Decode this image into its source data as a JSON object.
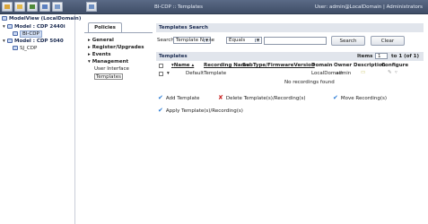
{
  "topbar": {
    "title": "BI-CDP :: Templates",
    "user": "User: admin@LocalDomain | Administrators",
    "icons": [
      "home-icon",
      "folder-icon",
      "chart-icon",
      "refresh-icon",
      "image-icon"
    ]
  },
  "tree": {
    "root": "ModelView (LocalDomain)",
    "model1": "Model : CDP 2440i",
    "model1_child": "BI-CDP",
    "model2": "Model : CDP 5040",
    "model2_child": "SJ_CDP"
  },
  "nav": {
    "tab": "Policies",
    "items": [
      "General",
      "Register/Upgrades",
      "Events",
      "Management"
    ],
    "sub_items": [
      "User Interface",
      "Templates"
    ]
  },
  "search": {
    "section_title": "Templates Search",
    "label": "Search:",
    "field_option": "Template Name",
    "operator_option": "Equals",
    "value": "",
    "search_button": "Search",
    "clear_button": "Clear"
  },
  "templates": {
    "section_title": "Templates",
    "items_label": "Items",
    "page_value": "1",
    "page_suffix": "to 1 (of 1)",
    "columns": [
      "Name",
      "Recording Name",
      "SubType/FirmwareVersion",
      "Domain",
      "Owner",
      "Description",
      "Configure"
    ],
    "row": {
      "name": "DefaultTemplate",
      "domain": "LocalDomain",
      "owner": "admin"
    },
    "empty_message": "No recordings found"
  },
  "actions": {
    "add": "Add Template",
    "delete": "Delete Template(s)/Recording(s)",
    "move": "Move Recording(s)",
    "apply": "Apply Template(s)/Recording(s)"
  }
}
